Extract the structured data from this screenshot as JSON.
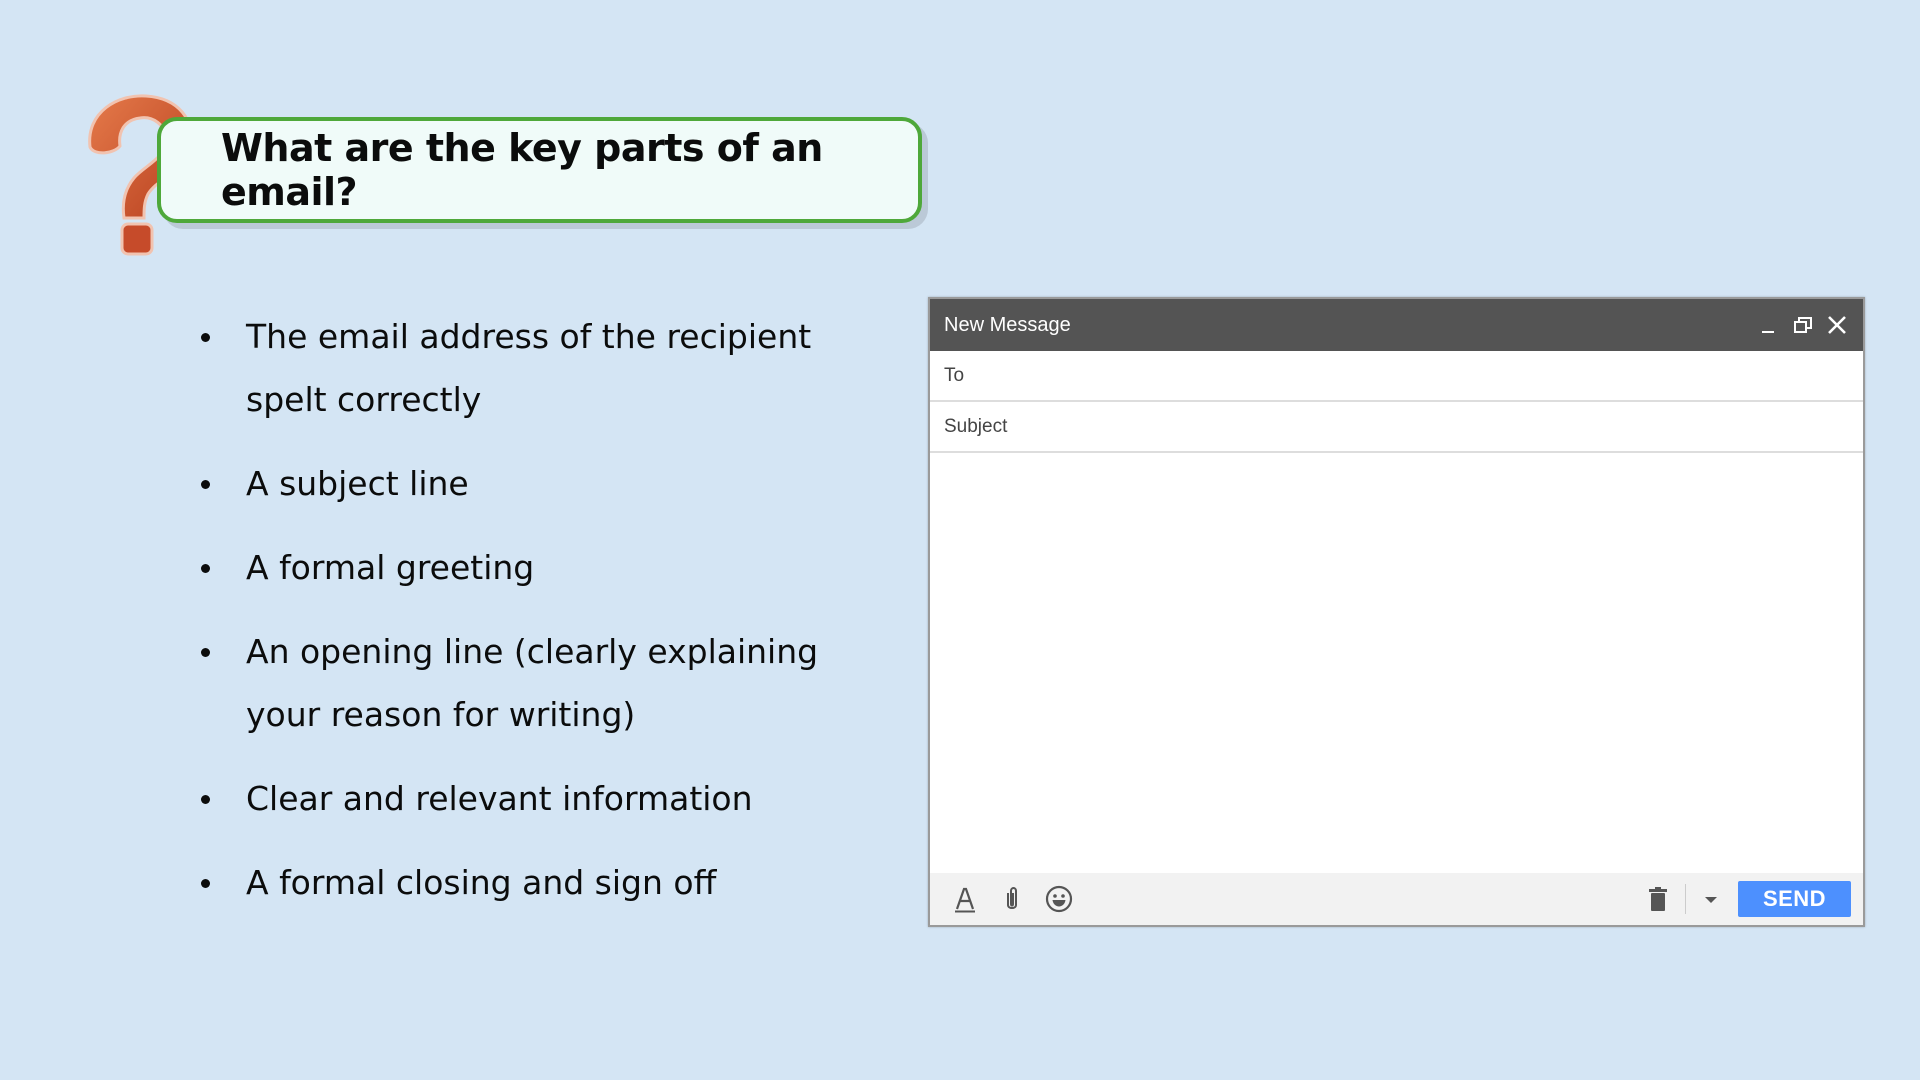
{
  "heading": {
    "question": "What are the key parts of an email?",
    "icon": "question-mark-icon",
    "border_color": "#4ea83a",
    "icon_color": "#c9502e"
  },
  "bullets": [
    "The email address of the recipient spelt correctly",
    "A subject line",
    "A formal greeting",
    "An opening line (clearly explaining your reason for writing)",
    "Clear and relevant information",
    "A formal closing and sign off"
  ],
  "compose": {
    "title": "New Message",
    "header_icons": [
      "minimize-icon",
      "popout-icon",
      "close-icon"
    ],
    "to_label": "To",
    "subject_label": "Subject",
    "body": "",
    "toolbar_icons": [
      "text-format-icon",
      "attach-icon",
      "emoji-icon",
      "trash-icon",
      "more-options-icon"
    ],
    "send_label": "SEND",
    "send_color": "#4d90fe",
    "header_color": "#545454"
  },
  "background_color": "#d4e5f4"
}
